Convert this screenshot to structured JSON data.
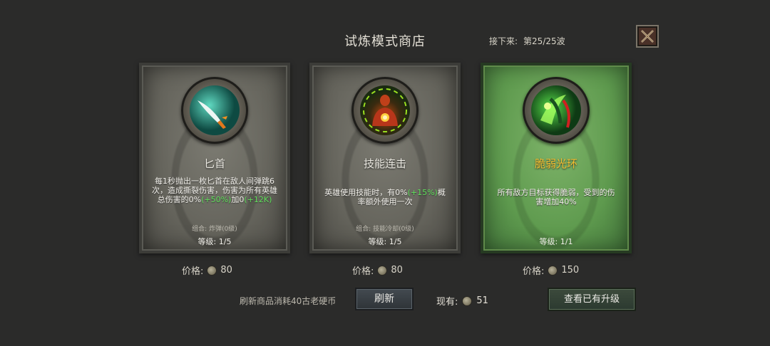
{
  "header": {
    "title": "试炼模式商店",
    "wave_label": "接下来:",
    "wave_value": "第25/25波"
  },
  "icons": {
    "close": "close-x-icon",
    "coin": "coin-icon"
  },
  "cards": [
    {
      "name": "匕首",
      "desc_1": "每1秒抛出一枚匕首在敌人间弹跳6次，造成撕裂伤害，伤害为所有英雄总伤害的0%",
      "desc_hl_1": "(+50%)",
      "desc_2": "加0",
      "desc_hl_2": "(+12K)",
      "combo": "组合: 炸弹(0级)",
      "level": "等级: 1/5",
      "price_label": "价格:",
      "price": "80",
      "icon": "dagger-icon"
    },
    {
      "name": "技能连击",
      "desc_1": "英雄使用技能时，有0%",
      "desc_hl_1": "(+15%)",
      "desc_2": "概率额外使用一次",
      "combo": "组合: 技能冷却(0级)",
      "level": "等级: 1/5",
      "price_label": "价格:",
      "price": "80",
      "icon": "skill-combo-icon"
    },
    {
      "name": "脆弱光环",
      "desc_1": "所有敌方目标获得脆弱，受到的伤害增加40%",
      "level": "等级: 1/1",
      "price_label": "价格:",
      "price": "150",
      "icon": "fragile-aura-icon",
      "selected": true
    }
  ],
  "footer": {
    "refresh_text": "刷新商品消耗40古老硬币",
    "refresh_button": "刷新",
    "owned_label": "现有:",
    "owned_value": "51",
    "view_upgrades_button": "查看已有升级"
  },
  "colors": {
    "background": "#2b2b2a",
    "card_normal": "#6f6e66",
    "card_selected": "#5e9a4e",
    "highlight_green": "#5fe05a",
    "selected_name": "#f4c030"
  }
}
